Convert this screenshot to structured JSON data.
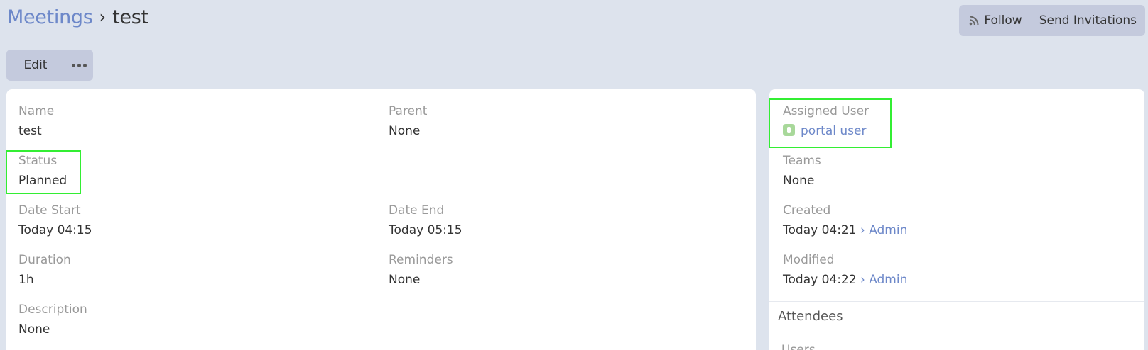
{
  "breadcrumb": {
    "parent": "Meetings",
    "separator": "›",
    "current": "test"
  },
  "header_actions": {
    "follow": "Follow",
    "send_invitations": "Send Invitations"
  },
  "toolbar": {
    "edit": "Edit"
  },
  "main": {
    "name": {
      "label": "Name",
      "value": "test"
    },
    "parent": {
      "label": "Parent",
      "value": "None"
    },
    "status": {
      "label": "Status",
      "value": "Planned"
    },
    "date_start": {
      "label": "Date Start",
      "value": "Today 04:15"
    },
    "date_end": {
      "label": "Date End",
      "value": "Today 05:15"
    },
    "duration": {
      "label": "Duration",
      "value": "1h"
    },
    "reminders": {
      "label": "Reminders",
      "value": "None"
    },
    "description": {
      "label": "Description",
      "value": "None"
    }
  },
  "side": {
    "assigned_user": {
      "label": "Assigned User",
      "value": "portal user"
    },
    "teams": {
      "label": "Teams",
      "value": "None"
    },
    "created": {
      "label": "Created",
      "value": "Today 04:21",
      "by": "Admin"
    },
    "modified": {
      "label": "Modified",
      "value": "Today 04:22",
      "by": "Admin"
    },
    "attendees_title": "Attendees",
    "users_label": "Users"
  },
  "colors": {
    "accent": "#6d88c9",
    "background": "#dde3ed",
    "button": "#c4cadd",
    "highlight": "#33ee33"
  }
}
